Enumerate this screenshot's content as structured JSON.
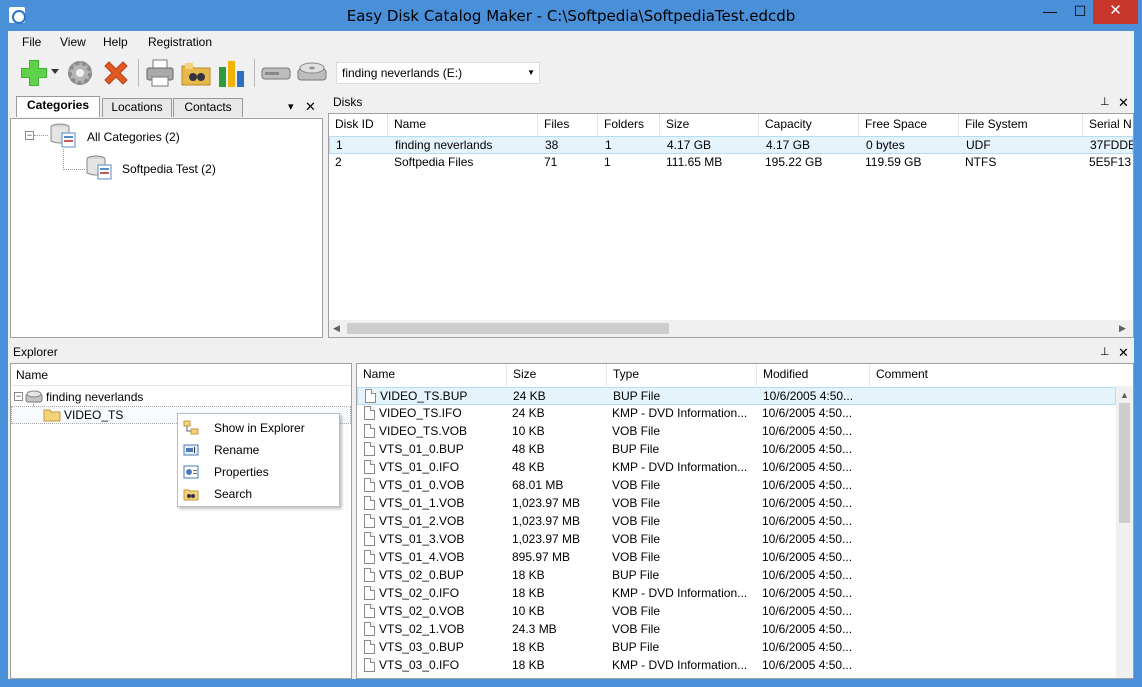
{
  "window": {
    "title": "Easy Disk Catalog Maker - C:\\Softpedia\\SoftpediaTest.edcdb",
    "min_label": "—",
    "max_label": "☐",
    "close_label": "✕"
  },
  "menu": {
    "items": [
      "File",
      "View",
      "Help",
      "Registration"
    ]
  },
  "toolbar": {
    "disk_select": "finding neverlands (E:)"
  },
  "tabs": [
    "Categories",
    "Locations",
    "Contacts"
  ],
  "categories_tree": {
    "root": "All Categories (2)",
    "child": "Softpedia Test (2)"
  },
  "disks_panel": {
    "title": "Disks",
    "columns": [
      "Disk ID",
      "Name",
      "Files",
      "Folders",
      "Size",
      "Capacity",
      "Free Space",
      "File System",
      "Serial N"
    ],
    "rows": [
      [
        "1",
        "finding neverlands",
        "38",
        "1",
        "4.17 GB",
        "4.17 GB",
        "0 bytes",
        "UDF",
        "37FDDE"
      ],
      [
        "2",
        "Softpedia Files",
        "71",
        "1",
        "111.65 MB",
        "195.22 GB",
        "119.59 GB",
        "NTFS",
        "5E5F13"
      ]
    ]
  },
  "explorer": {
    "title": "Explorer",
    "tree_header": "Name",
    "tree": {
      "root": "finding neverlands",
      "child": "VIDEO_TS"
    },
    "columns": [
      "Name",
      "Size",
      "Type",
      "Modified",
      "Comment"
    ],
    "rows": [
      [
        "VIDEO_TS.BUP",
        "24 KB",
        "BUP File",
        "10/6/2005 4:50..."
      ],
      [
        "VIDEO_TS.IFO",
        "24 KB",
        "KMP - DVD Information...",
        "10/6/2005 4:50..."
      ],
      [
        "VIDEO_TS.VOB",
        "10 KB",
        "VOB File",
        "10/6/2005 4:50..."
      ],
      [
        "VTS_01_0.BUP",
        "48 KB",
        "BUP File",
        "10/6/2005 4:50..."
      ],
      [
        "VTS_01_0.IFO",
        "48 KB",
        "KMP - DVD Information...",
        "10/6/2005 4:50..."
      ],
      [
        "VTS_01_0.VOB",
        "68.01 MB",
        "VOB File",
        "10/6/2005 4:50..."
      ],
      [
        "VTS_01_1.VOB",
        "1,023.97 MB",
        "VOB File",
        "10/6/2005 4:50..."
      ],
      [
        "VTS_01_2.VOB",
        "1,023.97 MB",
        "VOB File",
        "10/6/2005 4:50..."
      ],
      [
        "VTS_01_3.VOB",
        "1,023.97 MB",
        "VOB File",
        "10/6/2005 4:50..."
      ],
      [
        "VTS_01_4.VOB",
        "895.97 MB",
        "VOB File",
        "10/6/2005 4:50..."
      ],
      [
        "VTS_02_0.BUP",
        "18 KB",
        "BUP File",
        "10/6/2005 4:50..."
      ],
      [
        "VTS_02_0.IFO",
        "18 KB",
        "KMP - DVD Information...",
        "10/6/2005 4:50..."
      ],
      [
        "VTS_02_0.VOB",
        "10 KB",
        "VOB File",
        "10/6/2005 4:50..."
      ],
      [
        "VTS_02_1.VOB",
        "24.3 MB",
        "VOB File",
        "10/6/2005 4:50..."
      ],
      [
        "VTS_03_0.BUP",
        "18 KB",
        "BUP File",
        "10/6/2005 4:50..."
      ],
      [
        "VTS_03_0.IFO",
        "18 KB",
        "KMP - DVD Information...",
        "10/6/2005 4:50..."
      ]
    ]
  },
  "context_menu": {
    "items": [
      {
        "label": "Show in Explorer",
        "icon": "folder-tree-icon"
      },
      {
        "label": "Rename",
        "icon": "rename-icon"
      },
      {
        "label": "Properties",
        "icon": "properties-icon"
      },
      {
        "label": "Search",
        "icon": "search-folder-icon"
      }
    ]
  },
  "colors": {
    "title_bar": "#4a90d9",
    "close_button": "#c7352b",
    "selection": "#e5f3fb"
  }
}
